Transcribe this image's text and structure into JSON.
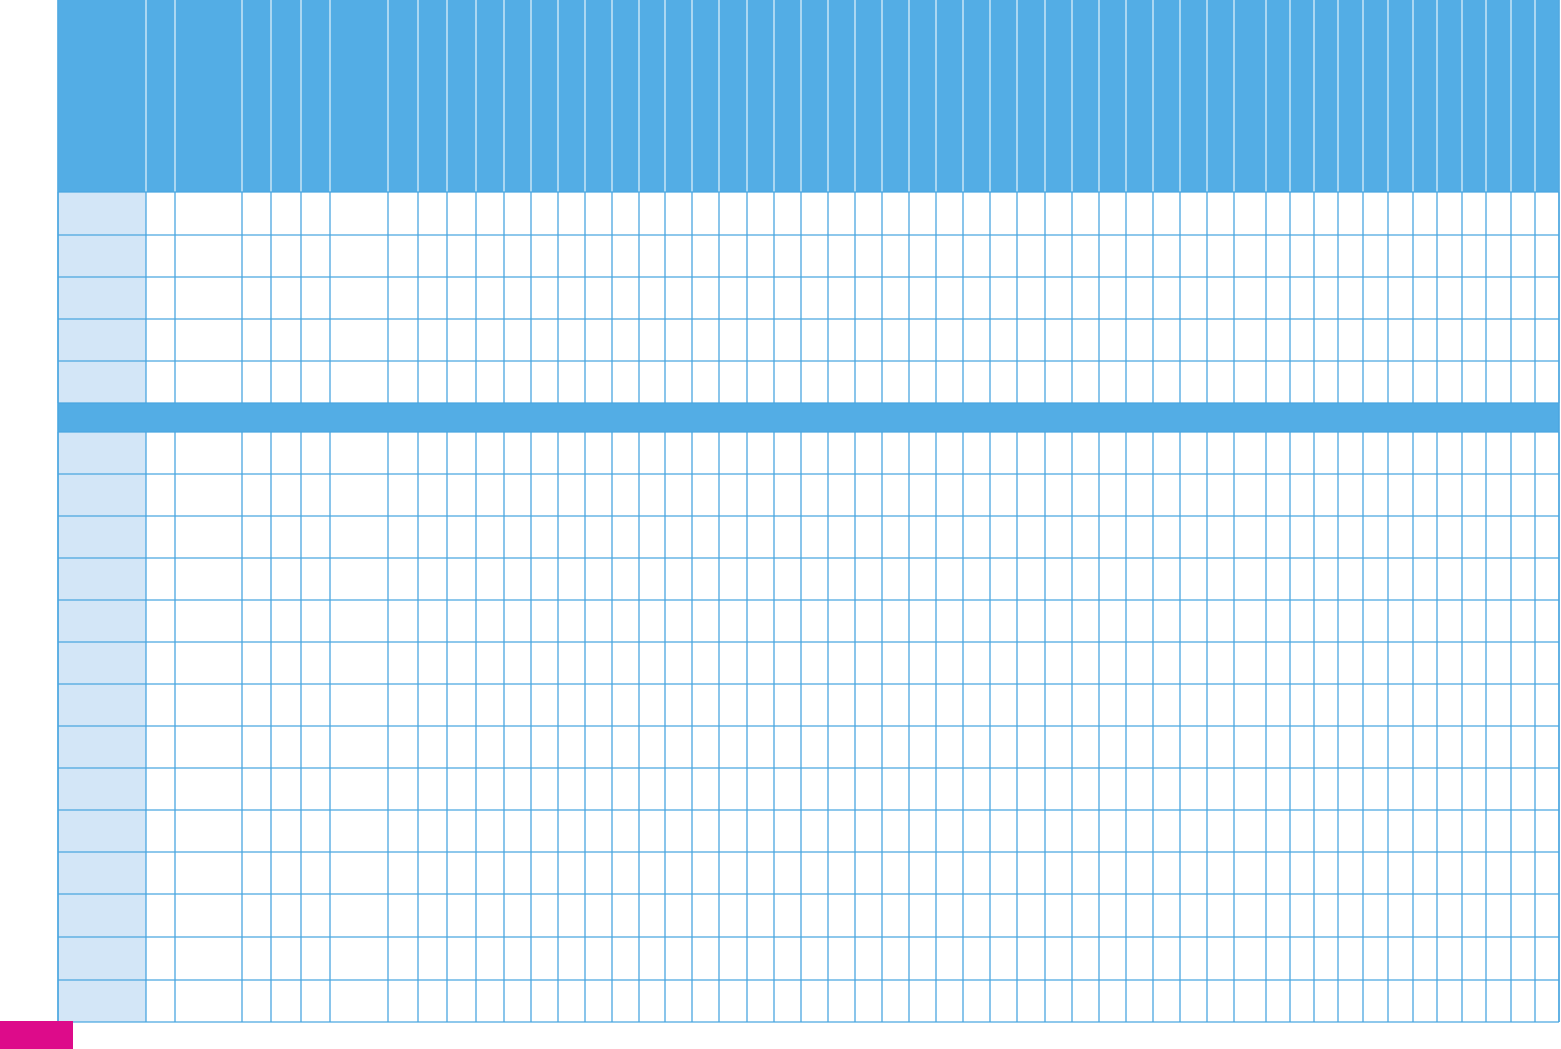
{
  "colors": {
    "header_fill": "#53ade5",
    "row_label_fill": "#d3e6f7",
    "grid_line": "#4aa6e0",
    "corner_tab": "#dd0b8a",
    "background": "#ffffff"
  },
  "table": {
    "header_cells": [],
    "top_rows": [
      "",
      "",
      "",
      "",
      ""
    ],
    "section_band_text": "",
    "bottom_rows": [
      "",
      "",
      "",
      "",
      "",
      "",
      "",
      "",
      "",
      "",
      "",
      "",
      "",
      ""
    ]
  }
}
